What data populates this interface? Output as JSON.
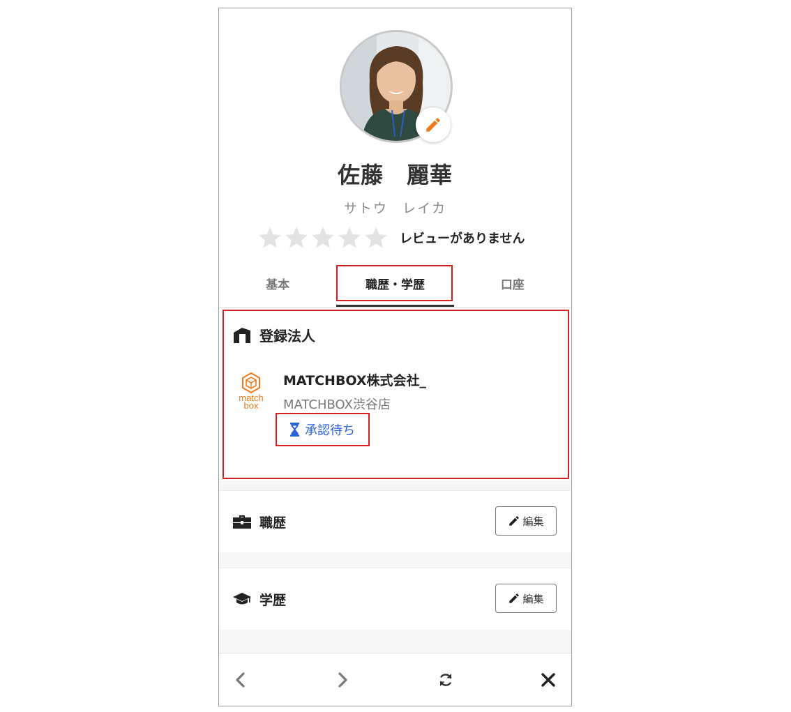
{
  "profile": {
    "name": "佐藤　麗華",
    "kana": "サトウ　レイカ",
    "rating": 0,
    "review_text": "レビューがありません",
    "icons": {
      "avatar": "avatar",
      "edit_photo": "pencil-icon",
      "star": "star-icon"
    }
  },
  "tabs": [
    {
      "label": "基本",
      "active": false
    },
    {
      "label": "職歴・学歴",
      "active": true
    },
    {
      "label": "口座",
      "active": false
    }
  ],
  "registered_corp": {
    "title": "登録法人",
    "icon": "building-icon",
    "company_name": "MATCHBOX株式会社_",
    "branch": "MATCHBOX渋谷店",
    "status": "承認待ち",
    "status_icon": "hourglass-icon",
    "logo_text_1": "match",
    "logo_text_2": "box"
  },
  "career": {
    "title": "職歴",
    "icon": "briefcase-icon",
    "edit_label": "編集"
  },
  "education": {
    "title": "学歴",
    "icon": "graduation-cap-icon",
    "edit_label": "編集"
  },
  "browser": {
    "icons": [
      "back-icon",
      "forward-icon",
      "reload-icon",
      "close-icon"
    ]
  },
  "colors": {
    "accent_orange": "#f07a1a",
    "status_blue": "#2a62d8",
    "highlight_red": "#d42020"
  }
}
